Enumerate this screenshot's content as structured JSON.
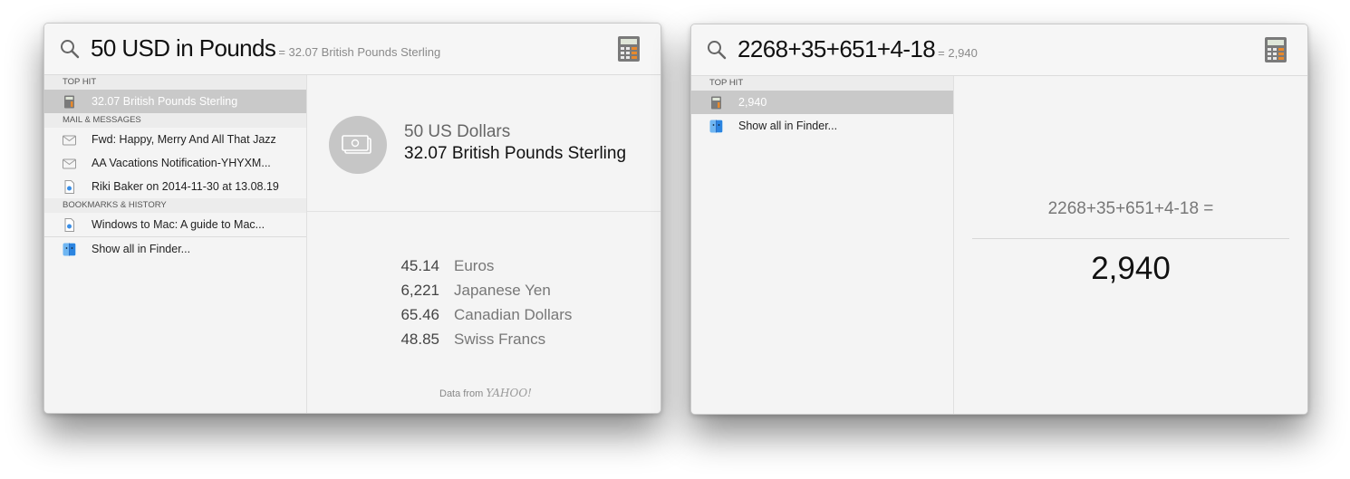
{
  "left_window": {
    "query": "50 USD in Pounds",
    "hint": "= 32.07 British Pounds Sterling",
    "sections": {
      "top_hit": "TOP HIT",
      "mail": "MAIL & MESSAGES",
      "bookmarks": "BOOKMARKS & HISTORY"
    },
    "items": {
      "top_hit": "32.07 British Pounds Sterling",
      "mail_1": "Fwd: Happy, Merry And All That Jazz",
      "mail_2": "AA Vacations Notification-YHYXM...",
      "mail_3": "Riki Baker on 2014-11-30 at 13.08.19",
      "bookmark_1": "Windows to Mac: A guide to Mac...",
      "show_all": "Show all in Finder..."
    },
    "detail": {
      "from": "50 US Dollars",
      "to": "32.07 British Pounds Sterling",
      "conversions": [
        {
          "value": "45.14",
          "name": "Euros"
        },
        {
          "value": "6,221",
          "name": "Japanese Yen"
        },
        {
          "value": "65.46",
          "name": "Canadian Dollars"
        },
        {
          "value": "48.85",
          "name": "Swiss Francs"
        }
      ],
      "credit_prefix": "Data from",
      "credit_brand": "YAHOO!"
    }
  },
  "right_window": {
    "query": "2268+35+651+4-18",
    "hint": "= 2,940",
    "sections": {
      "top_hit": "TOP HIT"
    },
    "items": {
      "top_hit": "2,940",
      "show_all": "Show all in Finder..."
    },
    "detail": {
      "expression": "2268+35+651+4-18 =",
      "result": "2,940"
    }
  },
  "colors": {
    "selection": "#c9c9c9",
    "background": "#f4f4f4"
  },
  "icons": [
    "magnifier-icon",
    "calculator-icon",
    "mail-icon",
    "document-icon",
    "finder-icon",
    "banknote-icon"
  ]
}
